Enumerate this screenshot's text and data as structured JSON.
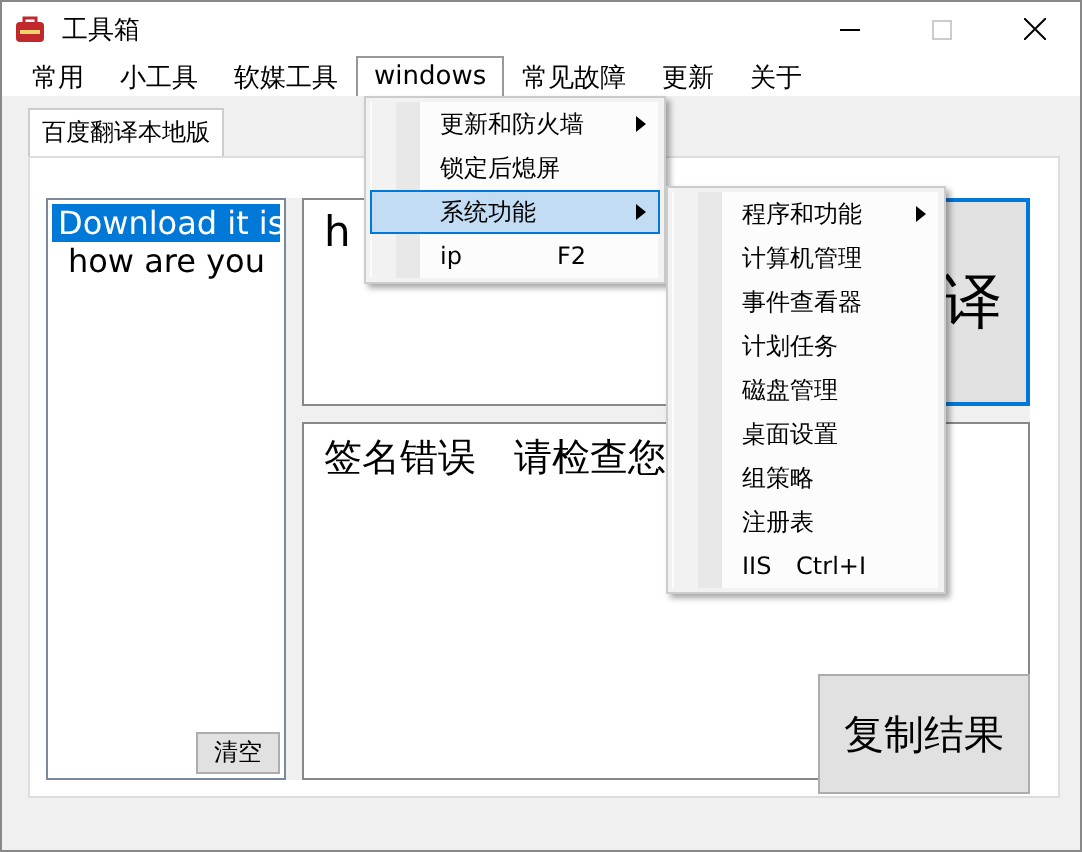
{
  "window": {
    "title": "工具箱"
  },
  "menu": [
    {
      "label": "常用",
      "selected": false
    },
    {
      "label": "小工具",
      "selected": false
    },
    {
      "label": "软媒工具",
      "selected": false
    },
    {
      "label": "windows",
      "selected": true
    },
    {
      "label": "常见故障",
      "selected": false
    },
    {
      "label": "更新",
      "selected": false
    },
    {
      "label": "关于",
      "selected": false
    }
  ],
  "dropdown": [
    {
      "label": "更新和防火墙",
      "submenu": true,
      "selected": false
    },
    {
      "label": "锁定后熄屏",
      "submenu": false,
      "selected": false
    },
    {
      "label": "系统功能",
      "submenu": true,
      "selected": true
    },
    {
      "label": "ip",
      "shortcut": "F2",
      "submenu": false,
      "selected": false
    }
  ],
  "submenu": [
    {
      "label": "程序和功能",
      "submenu": true
    },
    {
      "label": "计算机管理",
      "submenu": false
    },
    {
      "label": "事件查看器",
      "submenu": false
    },
    {
      "label": "计划任务",
      "submenu": false
    },
    {
      "label": "磁盘管理",
      "submenu": false
    },
    {
      "label": "桌面设置",
      "submenu": false
    },
    {
      "label": "组策略",
      "submenu": false
    },
    {
      "label": "注册表",
      "submenu": false
    },
    {
      "label": "IIS",
      "shortcut": "Ctrl+I",
      "submenu": false
    }
  ],
  "tabs": [
    {
      "label": "百度翻译本地版",
      "selected": true
    }
  ],
  "history": {
    "items": [
      {
        "text": "Download it is",
        "selected": true
      },
      {
        "text": "how are you",
        "selected": false
      }
    ],
    "clear_button": "清空"
  },
  "input": {
    "value": "h"
  },
  "translate_button": {
    "label": "译"
  },
  "output": {
    "value": "签名错误　请检查您"
  },
  "copy_button": {
    "label": "复制结果"
  }
}
